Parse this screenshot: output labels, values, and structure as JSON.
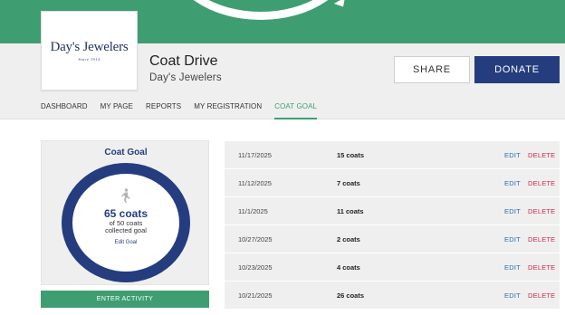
{
  "brand": {
    "logo_text": "Day's Jewelers",
    "logo_tagline": "Since 1914"
  },
  "page": {
    "title": "Coat Drive",
    "subtitle": "Day's Jewelers"
  },
  "actions": {
    "share_label": "SHARE",
    "donate_label": "DONATE"
  },
  "nav": {
    "items": [
      {
        "label": "DASHBOARD",
        "active": false
      },
      {
        "label": "MY PAGE",
        "active": false
      },
      {
        "label": "REPORTS",
        "active": false
      },
      {
        "label": "MY REGISTRATION",
        "active": false
      },
      {
        "label": "COAT GOAL",
        "active": true
      }
    ]
  },
  "goal": {
    "title": "Coat Goal",
    "count": "65 coats",
    "of_line1": "of 50 coats",
    "of_line2": "collected goal",
    "edit_label": "Edit Goal",
    "enter_activity_label": "ENTER ACTIVITY"
  },
  "activities": [
    {
      "date": "11/17/2025",
      "amount": "15 coats",
      "edit": "EDIT",
      "delete": "DELETE"
    },
    {
      "date": "11/12/2025",
      "amount": "7 coats",
      "edit": "EDIT",
      "delete": "DELETE"
    },
    {
      "date": "11/1/2025",
      "amount": "11 coats",
      "edit": "EDIT",
      "delete": "DELETE"
    },
    {
      "date": "10/27/2025",
      "amount": "2 coats",
      "edit": "EDIT",
      "delete": "DELETE"
    },
    {
      "date": "10/23/2025",
      "amount": "4 coats",
      "edit": "EDIT",
      "delete": "DELETE"
    },
    {
      "date": "10/21/2025",
      "amount": "26 coats",
      "edit": "EDIT",
      "delete": "DELETE"
    }
  ],
  "colors": {
    "brand_green": "#3e9e72",
    "navy": "#253d7e",
    "delete_red": "#cc2b50",
    "edit_blue": "#2e6fa8"
  },
  "icons": {
    "goal_icon": "walking-person-icon",
    "banner_graphic": "circular-arrow-icon"
  }
}
